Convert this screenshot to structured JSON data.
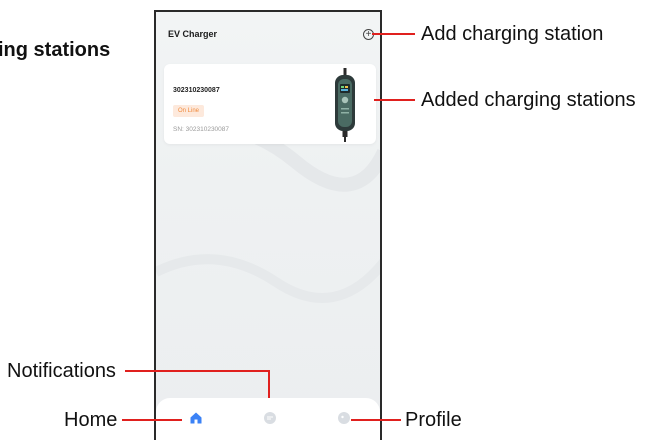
{
  "callouts": {
    "top_left_fragment": "ing stations",
    "add_charging_station": "Add charging station",
    "added_charging_stations": "Added charging stations",
    "notifications": "Notifications",
    "home": "Home",
    "profile": "Profile"
  },
  "app": {
    "title": "EV Charger"
  },
  "station": {
    "name": "302310230087",
    "status": "On Line",
    "sn_label": "SN:",
    "sn_value": "302310230087",
    "sn_text": "SN:  302310230087"
  },
  "tabs": [
    {
      "name": "Home",
      "icon": "home-icon",
      "active": true
    },
    {
      "name": "Notifications",
      "icon": "chat-bubble-icon",
      "active": false
    },
    {
      "name": "Profile",
      "icon": "profile-icon",
      "active": false
    }
  ],
  "colors": {
    "callout_line": "#e0201e",
    "active_tab": "#3b82f6",
    "inactive_tab": "#d9dde2",
    "status_text": "#f08a3c",
    "status_bg": "#fde9dc"
  }
}
